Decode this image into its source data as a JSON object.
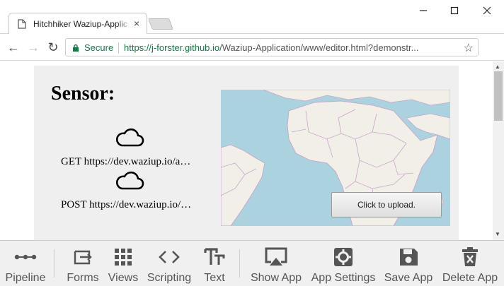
{
  "browser": {
    "tab_title": "Hitchhiker Waziup-Applic",
    "tab_close": "×",
    "window_controls": {
      "minimize": "—",
      "maximize": "☐",
      "close": "✕"
    },
    "nav": {
      "back": "←",
      "forward": "→",
      "reload": "↻"
    },
    "secure_label": "Secure",
    "url_scheme": "https://",
    "url_host": "j-forster.github.io",
    "url_rest": "/Waziup-Application/www/editor.html?demonstr...",
    "bookmark_star": "☆",
    "menu": "⋮"
  },
  "page": {
    "sensor_title": "Sensor:",
    "get_request": "GET https://dev.waziup.io/a…",
    "post_request": "POST https://dev.waziup.io/…",
    "upload_button": "Click to upload."
  },
  "toolbar": {
    "items": [
      {
        "label": "Pipeline",
        "icon": "pipeline-icon"
      },
      {
        "label": "Forms",
        "icon": "forms-icon"
      },
      {
        "label": "Views",
        "icon": "views-icon"
      },
      {
        "label": "Scripting",
        "icon": "scripting-icon"
      },
      {
        "label": "Text",
        "icon": "text-icon"
      },
      {
        "label": "Show App",
        "icon": "show-app-icon"
      },
      {
        "label": "App Settings",
        "icon": "app-settings-icon"
      },
      {
        "label": "Save App",
        "icon": "save-app-icon"
      },
      {
        "label": "Delete App",
        "icon": "delete-app-icon"
      }
    ]
  },
  "colors": {
    "secure_green": "#0b8043",
    "map_water": "#aad3df",
    "map_land": "#f2efe9",
    "map_border": "#c7a5c8",
    "panel_bg": "#efefef",
    "toolbar_bg": "#f0f0f0",
    "icon_gray": "#555555"
  }
}
